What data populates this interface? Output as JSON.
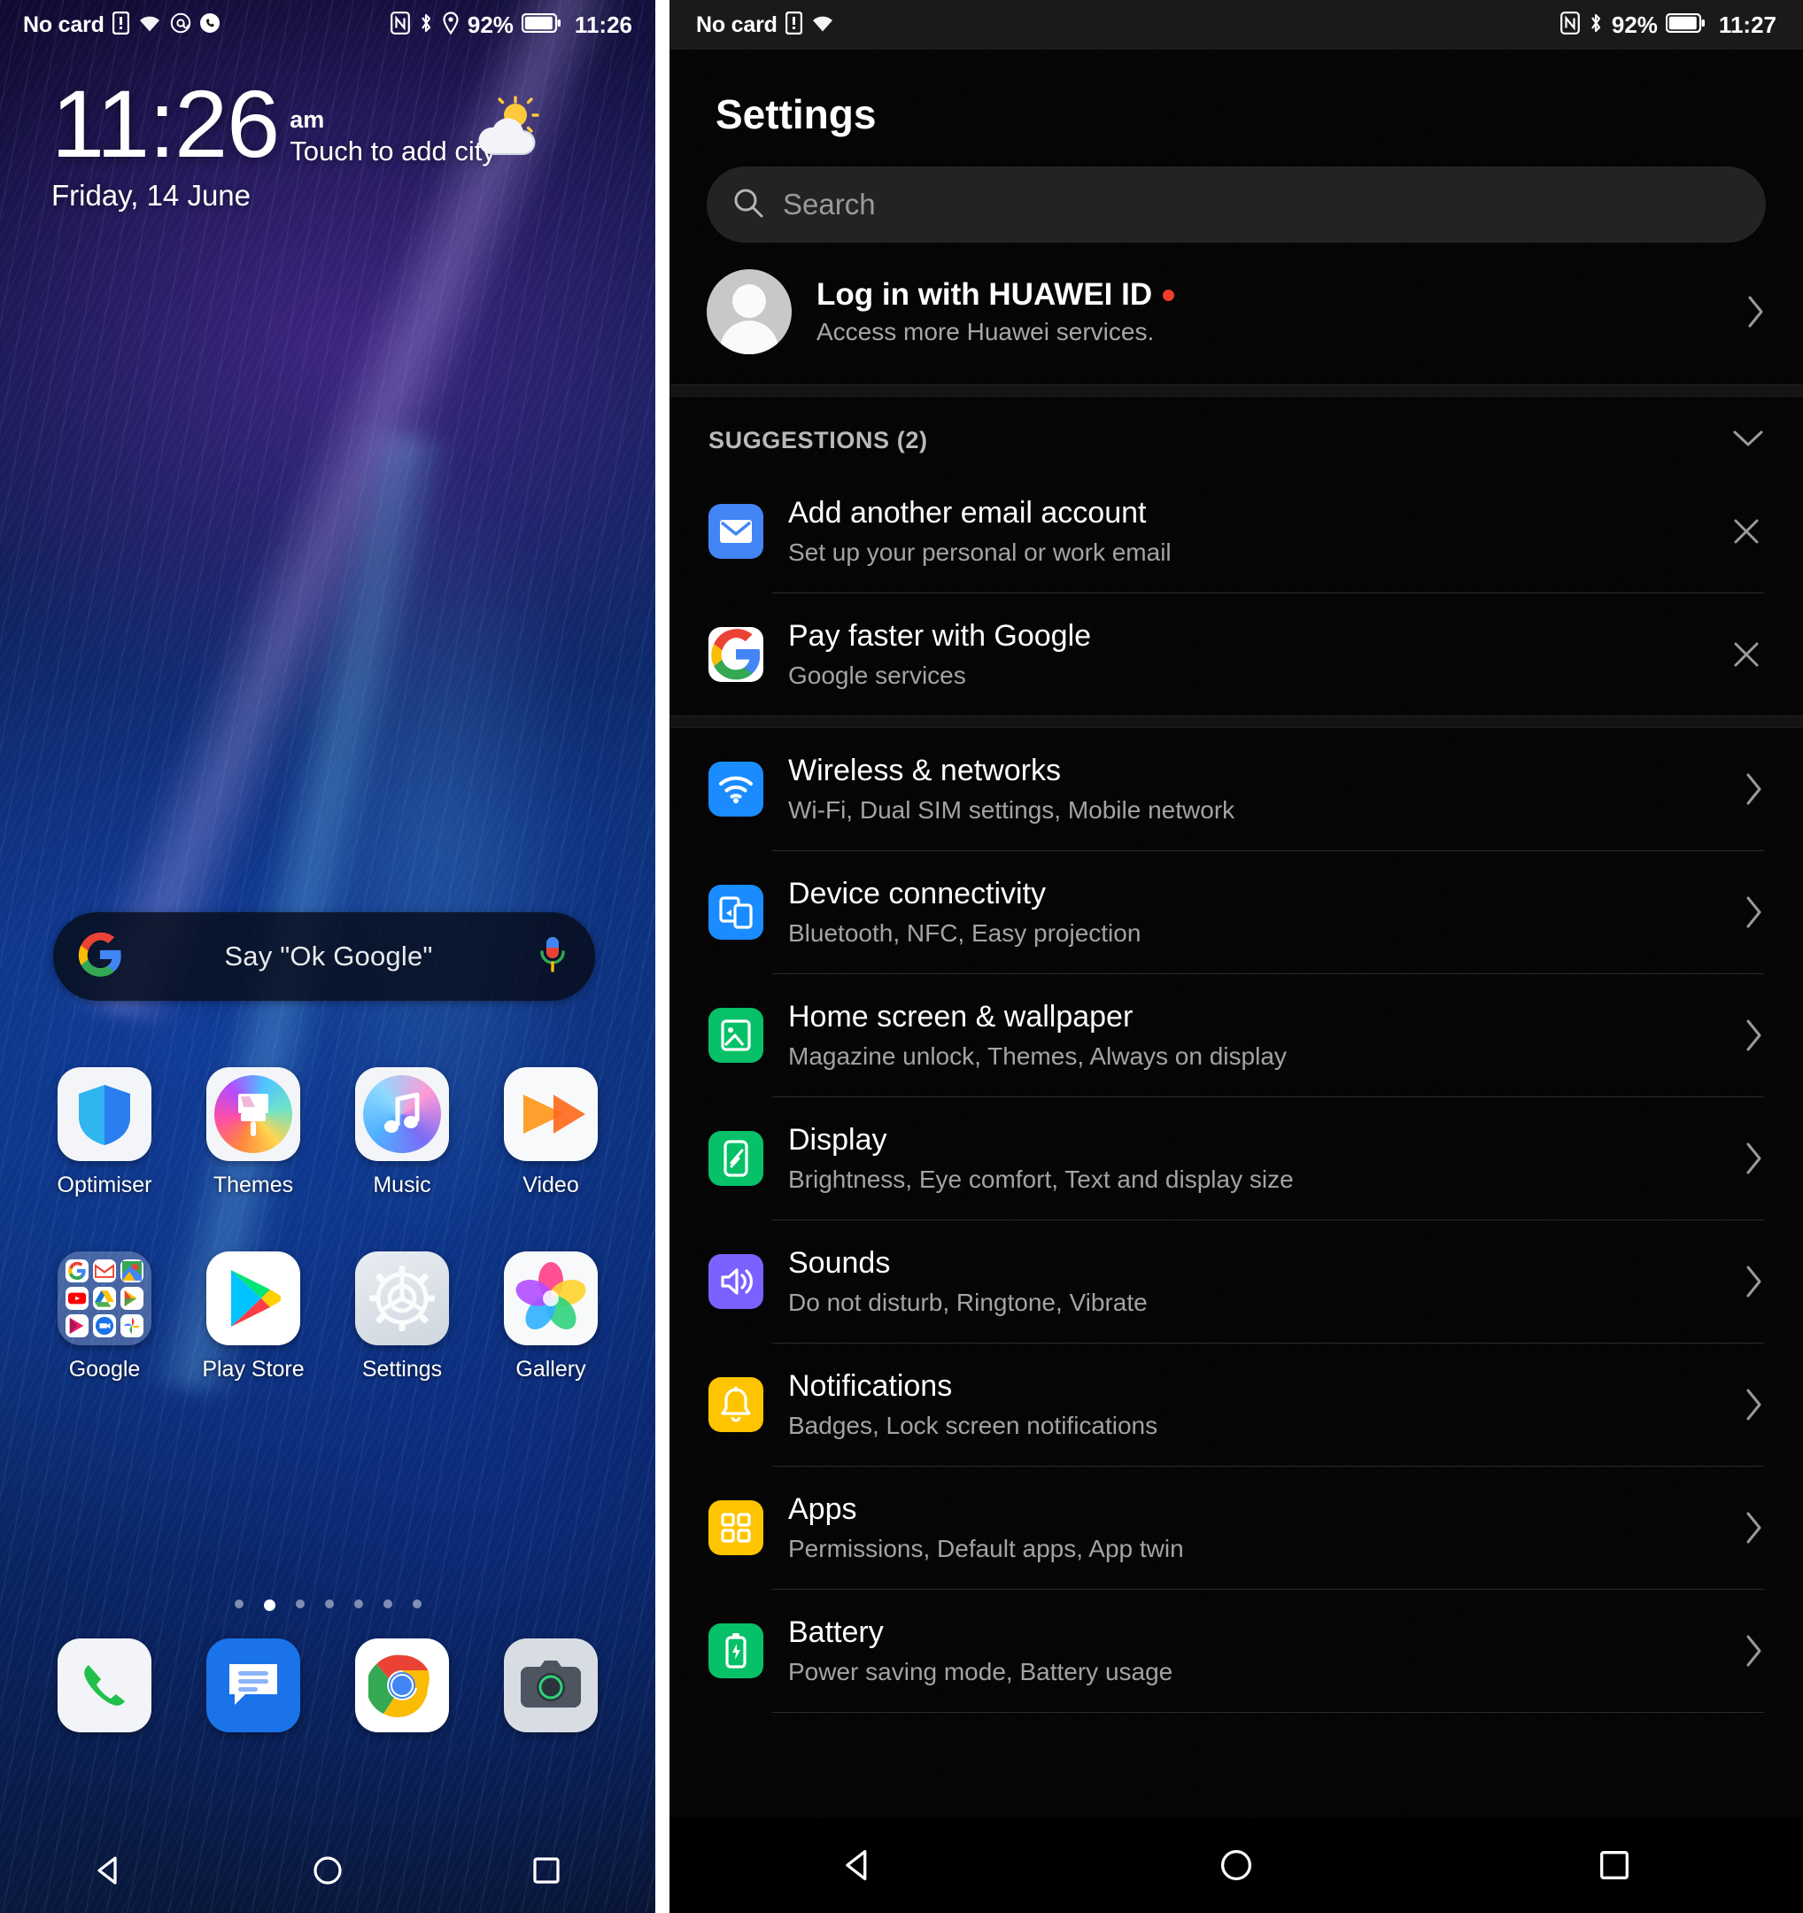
{
  "home": {
    "statusbar": {
      "carrier": "No card",
      "battery_percent": "92%",
      "clock": "11:26",
      "icons": [
        "sim-card-alert-icon",
        "wifi-icon",
        "at-sign-icon",
        "missed-call-icon",
        "nfc-icon",
        "bluetooth-icon",
        "location-icon",
        "battery-icon"
      ]
    },
    "clock_widget": {
      "time": "11:26",
      "meridiem": "am",
      "city_hint": "Touch to add city",
      "date": "Friday, 14 June",
      "weather_icon": "sun-behind-cloud-icon"
    },
    "search_widget": {
      "hint": "Say \"Ok Google\"",
      "logo_icon": "google-g-icon",
      "mic_icon": "microphone-icon"
    },
    "apps_row1": [
      {
        "label": "Optimiser",
        "icon": "optimiser-shield-icon"
      },
      {
        "label": "Themes",
        "icon": "themes-brush-icon"
      },
      {
        "label": "Music",
        "icon": "music-note-icon"
      },
      {
        "label": "Video",
        "icon": "video-play-icon"
      }
    ],
    "apps_row2": [
      {
        "label": "Google",
        "icon": "google-folder-icon"
      },
      {
        "label": "Play Store",
        "icon": "play-store-icon"
      },
      {
        "label": "Settings",
        "icon": "settings-gear-icon"
      },
      {
        "label": "Gallery",
        "icon": "gallery-flower-icon"
      }
    ],
    "google_folder_apps": [
      "Google",
      "Gmail",
      "Maps",
      "YouTube",
      "Drive",
      "Play Movies",
      "Play Music",
      "Duo",
      "Photos"
    ],
    "page_dots": {
      "count": 7,
      "active_index": 1
    },
    "dock": [
      {
        "label": "Phone",
        "icon": "phone-handset-icon"
      },
      {
        "label": "Messages",
        "icon": "messages-bubble-icon"
      },
      {
        "label": "Chrome",
        "icon": "chrome-icon"
      },
      {
        "label": "Camera",
        "icon": "camera-icon"
      }
    ],
    "navbar": [
      {
        "label": "Back",
        "icon": "back-triangle-icon"
      },
      {
        "label": "Home",
        "icon": "home-circle-icon"
      },
      {
        "label": "Recents",
        "icon": "recents-square-icon"
      }
    ]
  },
  "settings": {
    "statusbar": {
      "carrier": "No card",
      "battery_percent": "92%",
      "clock": "11:27",
      "icons": [
        "sim-card-alert-icon",
        "wifi-icon",
        "nfc-icon",
        "bluetooth-icon",
        "battery-icon"
      ]
    },
    "title": "Settings",
    "search": {
      "placeholder": "Search",
      "icon": "search-icon"
    },
    "account": {
      "title": "Log in with HUAWEI ID",
      "subtitle": "Access more Huawei services.",
      "has_red_dot": true,
      "avatar_icon": "default-avatar-icon",
      "chevron_icon": "chevron-right-icon"
    },
    "suggestions_header": {
      "label": "SUGGESTIONS (2)",
      "collapse_icon": "chevron-down-icon"
    },
    "suggestions": [
      {
        "title": "Add another email account",
        "subtitle": "Set up your personal or work email",
        "icon": "email-envelope-icon",
        "icon_color": "#4285f4",
        "dismiss_icon": "close-x-icon"
      },
      {
        "title": "Pay faster with Google",
        "subtitle": "Google services",
        "icon": "google-g-icon",
        "icon_color": "#ffffff",
        "dismiss_icon": "close-x-icon"
      }
    ],
    "items": [
      {
        "title": "Wireless & networks",
        "subtitle": "Wi-Fi, Dual SIM settings, Mobile network",
        "icon": "wifi-signal-icon",
        "icon_color": "#1a8cff",
        "chevron_icon": "chevron-right-icon"
      },
      {
        "title": "Device connectivity",
        "subtitle": "Bluetooth, NFC, Easy projection",
        "icon": "device-connectivity-icon",
        "icon_color": "#1a8cff",
        "chevron_icon": "chevron-right-icon"
      },
      {
        "title": "Home screen & wallpaper",
        "subtitle": "Magazine unlock, Themes, Always on display",
        "icon": "wallpaper-image-icon",
        "icon_color": "#06c167",
        "chevron_icon": "chevron-right-icon"
      },
      {
        "title": "Display",
        "subtitle": "Brightness, Eye comfort, Text and display size",
        "icon": "display-phone-icon",
        "icon_color": "#06c167",
        "chevron_icon": "chevron-right-icon"
      },
      {
        "title": "Sounds",
        "subtitle": "Do not disturb, Ringtone, Vibrate",
        "icon": "speaker-volume-icon",
        "icon_color": "#7b61ff",
        "chevron_icon": "chevron-right-icon"
      },
      {
        "title": "Notifications",
        "subtitle": "Badges, Lock screen notifications",
        "icon": "bell-icon",
        "icon_color": "#ffc400",
        "chevron_icon": "chevron-right-icon"
      },
      {
        "title": "Apps",
        "subtitle": "Permissions, Default apps, App twin",
        "icon": "apps-grid-icon",
        "icon_color": "#ffc400",
        "chevron_icon": "chevron-right-icon"
      },
      {
        "title": "Battery",
        "subtitle": "Power saving mode, Battery usage",
        "icon": "battery-bolt-icon",
        "icon_color": "#06c167",
        "chevron_icon": "chevron-right-icon"
      }
    ],
    "navbar": [
      {
        "label": "Back",
        "icon": "back-triangle-icon"
      },
      {
        "label": "Home",
        "icon": "home-circle-icon"
      },
      {
        "label": "Recents",
        "icon": "recents-square-icon"
      }
    ]
  },
  "colors": {
    "accent_blue": "#1a8cff",
    "accent_green": "#06c167",
    "accent_yellow": "#ffc400",
    "accent_purple": "#7b61ff",
    "red_dot": "#f03d2b"
  }
}
